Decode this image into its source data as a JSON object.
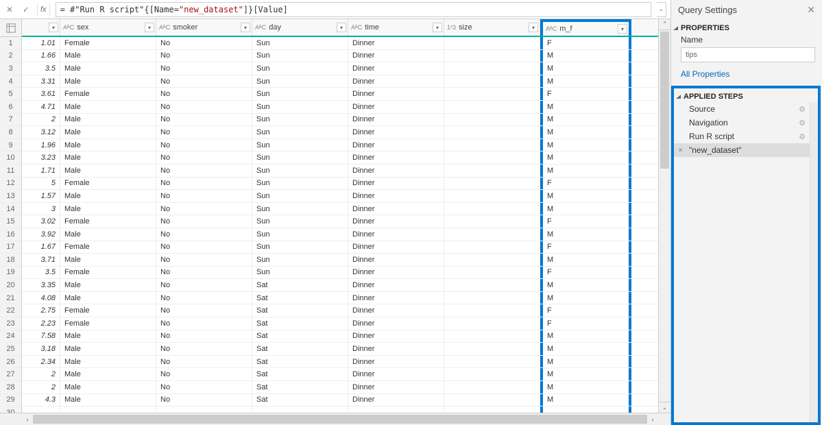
{
  "formula_bar": {
    "prefix": "= #\"Run R script\"{[Name=",
    "name_literal": "\"new_dataset\"",
    "suffix": "]}[Value]"
  },
  "columns": [
    {
      "type": "",
      "label": ""
    },
    {
      "type": "ABC",
      "label": "sex"
    },
    {
      "type": "ABC",
      "label": "smoker"
    },
    {
      "type": "ABC",
      "label": "day"
    },
    {
      "type": "ABC",
      "label": "time"
    },
    {
      "type": "123",
      "label": "size"
    },
    {
      "type": "ABC",
      "label": "m_f"
    }
  ],
  "rows": [
    {
      "n": 1,
      "v0": "1.01",
      "sex": "Female",
      "smoker": "No",
      "day": "Sun",
      "time": "Dinner",
      "size": "",
      "mf": "F"
    },
    {
      "n": 2,
      "v0": "1.66",
      "sex": "Male",
      "smoker": "No",
      "day": "Sun",
      "time": "Dinner",
      "size": "",
      "mf": "M"
    },
    {
      "n": 3,
      "v0": "3.5",
      "sex": "Male",
      "smoker": "No",
      "day": "Sun",
      "time": "Dinner",
      "size": "",
      "mf": "M"
    },
    {
      "n": 4,
      "v0": "3.31",
      "sex": "Male",
      "smoker": "No",
      "day": "Sun",
      "time": "Dinner",
      "size": "",
      "mf": "M"
    },
    {
      "n": 5,
      "v0": "3.61",
      "sex": "Female",
      "smoker": "No",
      "day": "Sun",
      "time": "Dinner",
      "size": "",
      "mf": "F"
    },
    {
      "n": 6,
      "v0": "4.71",
      "sex": "Male",
      "smoker": "No",
      "day": "Sun",
      "time": "Dinner",
      "size": "",
      "mf": "M"
    },
    {
      "n": 7,
      "v0": "2",
      "sex": "Male",
      "smoker": "No",
      "day": "Sun",
      "time": "Dinner",
      "size": "",
      "mf": "M"
    },
    {
      "n": 8,
      "v0": "3.12",
      "sex": "Male",
      "smoker": "No",
      "day": "Sun",
      "time": "Dinner",
      "size": "",
      "mf": "M"
    },
    {
      "n": 9,
      "v0": "1.96",
      "sex": "Male",
      "smoker": "No",
      "day": "Sun",
      "time": "Dinner",
      "size": "",
      "mf": "M"
    },
    {
      "n": 10,
      "v0": "3.23",
      "sex": "Male",
      "smoker": "No",
      "day": "Sun",
      "time": "Dinner",
      "size": "",
      "mf": "M"
    },
    {
      "n": 11,
      "v0": "1.71",
      "sex": "Male",
      "smoker": "No",
      "day": "Sun",
      "time": "Dinner",
      "size": "",
      "mf": "M"
    },
    {
      "n": 12,
      "v0": "5",
      "sex": "Female",
      "smoker": "No",
      "day": "Sun",
      "time": "Dinner",
      "size": "",
      "mf": "F"
    },
    {
      "n": 13,
      "v0": "1.57",
      "sex": "Male",
      "smoker": "No",
      "day": "Sun",
      "time": "Dinner",
      "size": "",
      "mf": "M"
    },
    {
      "n": 14,
      "v0": "3",
      "sex": "Male",
      "smoker": "No",
      "day": "Sun",
      "time": "Dinner",
      "size": "",
      "mf": "M"
    },
    {
      "n": 15,
      "v0": "3.02",
      "sex": "Female",
      "smoker": "No",
      "day": "Sun",
      "time": "Dinner",
      "size": "",
      "mf": "F"
    },
    {
      "n": 16,
      "v0": "3.92",
      "sex": "Male",
      "smoker": "No",
      "day": "Sun",
      "time": "Dinner",
      "size": "",
      "mf": "M"
    },
    {
      "n": 17,
      "v0": "1.67",
      "sex": "Female",
      "smoker": "No",
      "day": "Sun",
      "time": "Dinner",
      "size": "",
      "mf": "F"
    },
    {
      "n": 18,
      "v0": "3.71",
      "sex": "Male",
      "smoker": "No",
      "day": "Sun",
      "time": "Dinner",
      "size": "",
      "mf": "M"
    },
    {
      "n": 19,
      "v0": "3.5",
      "sex": "Female",
      "smoker": "No",
      "day": "Sun",
      "time": "Dinner",
      "size": "",
      "mf": "F"
    },
    {
      "n": 20,
      "v0": "3.35",
      "sex": "Male",
      "smoker": "No",
      "day": "Sat",
      "time": "Dinner",
      "size": "",
      "mf": "M"
    },
    {
      "n": 21,
      "v0": "4.08",
      "sex": "Male",
      "smoker": "No",
      "day": "Sat",
      "time": "Dinner",
      "size": "",
      "mf": "M"
    },
    {
      "n": 22,
      "v0": "2.75",
      "sex": "Female",
      "smoker": "No",
      "day": "Sat",
      "time": "Dinner",
      "size": "",
      "mf": "F"
    },
    {
      "n": 23,
      "v0": "2.23",
      "sex": "Female",
      "smoker": "No",
      "day": "Sat",
      "time": "Dinner",
      "size": "",
      "mf": "F"
    },
    {
      "n": 24,
      "v0": "7.58",
      "sex": "Male",
      "smoker": "No",
      "day": "Sat",
      "time": "Dinner",
      "size": "",
      "mf": "M"
    },
    {
      "n": 25,
      "v0": "3.18",
      "sex": "Male",
      "smoker": "No",
      "day": "Sat",
      "time": "Dinner",
      "size": "",
      "mf": "M"
    },
    {
      "n": 26,
      "v0": "2.34",
      "sex": "Male",
      "smoker": "No",
      "day": "Sat",
      "time": "Dinner",
      "size": "",
      "mf": "M"
    },
    {
      "n": 27,
      "v0": "2",
      "sex": "Male",
      "smoker": "No",
      "day": "Sat",
      "time": "Dinner",
      "size": "",
      "mf": "M"
    },
    {
      "n": 28,
      "v0": "2",
      "sex": "Male",
      "smoker": "No",
      "day": "Sat",
      "time": "Dinner",
      "size": "",
      "mf": "M"
    },
    {
      "n": 29,
      "v0": "4.3",
      "sex": "Male",
      "smoker": "No",
      "day": "Sat",
      "time": "Dinner",
      "size": "",
      "mf": "M"
    },
    {
      "n": 30,
      "v0": "",
      "sex": "",
      "smoker": "",
      "day": "",
      "time": "",
      "size": "",
      "mf": ""
    }
  ],
  "right_panel": {
    "title": "Query Settings",
    "properties_label": "PROPERTIES",
    "name_label": "Name",
    "name_value": "tips",
    "all_properties": "All Properties",
    "applied_steps_label": "APPLIED STEPS",
    "steps": [
      {
        "label": "Source",
        "gear": true,
        "selected": false
      },
      {
        "label": "Navigation",
        "gear": true,
        "selected": false
      },
      {
        "label": "Run R script",
        "gear": true,
        "selected": false
      },
      {
        "label": "\"new_dataset\"",
        "gear": false,
        "selected": true
      }
    ]
  }
}
